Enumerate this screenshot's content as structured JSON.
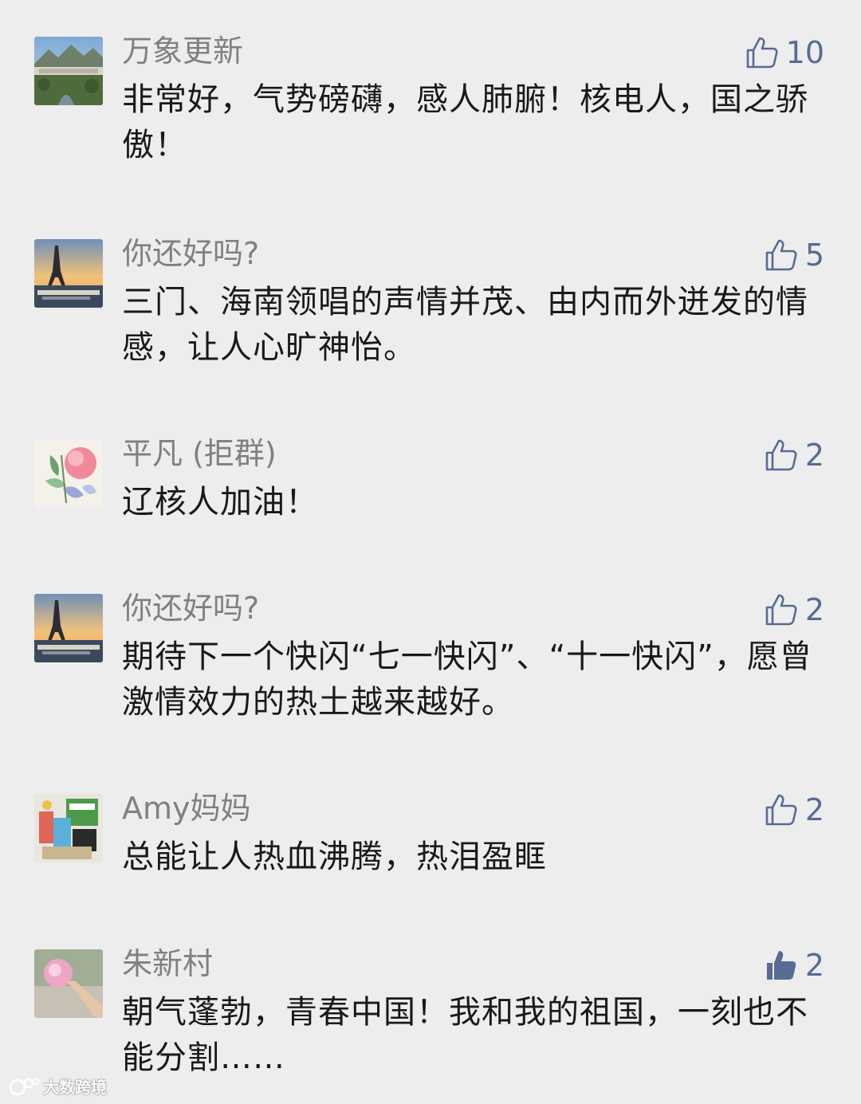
{
  "colors": {
    "background": "#ededed",
    "name": "#808080",
    "text": "#191919",
    "like_accent": "#576b95"
  },
  "comments": [
    {
      "name": "万象更新",
      "likes": "10",
      "liked": false,
      "avatar_icon": "mountain-landscape-avatar",
      "text": "非常好，气势磅礴，感人肺腑！核电人，国之骄傲！"
    },
    {
      "name": "你还好吗?",
      "likes": "5",
      "liked": false,
      "avatar_icon": "eiffel-tower-avatar",
      "text": "三门、海南领唱的声情并茂、由内而外迸发的情感，让人心旷神怡。"
    },
    {
      "name": "平凡 (拒群)",
      "likes": "2",
      "liked": false,
      "avatar_icon": "flower-painting-avatar",
      "text": "辽核人加油！"
    },
    {
      "name": "你还好吗?",
      "likes": "2",
      "liked": false,
      "avatar_icon": "eiffel-tower-avatar",
      "text": "期待下一个快闪“七一快闪”、“十一快闪”，愿曾激情效力的热土越来越好。"
    },
    {
      "name": "Amy妈妈",
      "likes": "2",
      "liked": false,
      "avatar_icon": "products-photo-avatar",
      "text": "总能让人热血沸腾，热泪盈眶"
    },
    {
      "name": "朱新村",
      "likes": "2",
      "liked": true,
      "avatar_icon": "pink-flower-avatar",
      "text": "朝气蓬勃，青春中国！我和我的祖国，一刻也不能分割……"
    }
  ],
  "watermark": {
    "text": "大数跨境"
  }
}
